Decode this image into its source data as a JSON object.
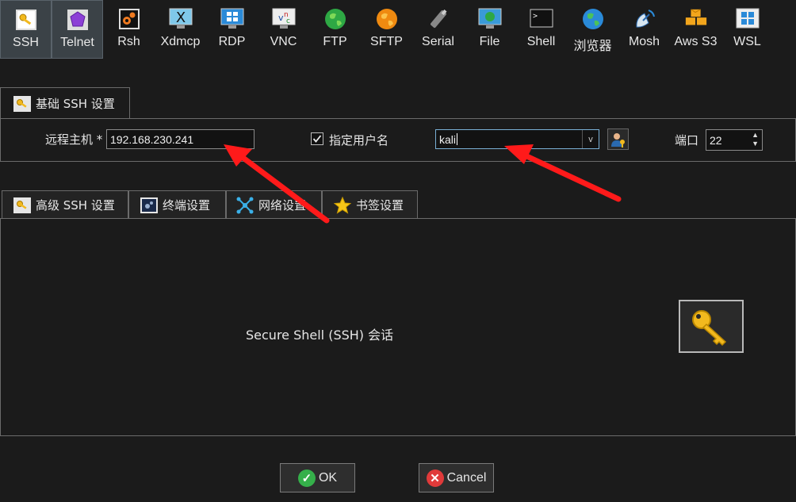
{
  "session_types": [
    {
      "label": "SSH",
      "icon": "ssh-key-icon",
      "active": true
    },
    {
      "label": "Telnet",
      "icon": "telnet-gem-icon",
      "active": true
    },
    {
      "label": "Rsh",
      "icon": "rsh-gears-icon"
    },
    {
      "label": "Xdmcp",
      "icon": "xdmcp-monitor-icon"
    },
    {
      "label": "RDP",
      "icon": "rdp-windows-monitor-icon"
    },
    {
      "label": "VNC",
      "icon": "vnc-icon"
    },
    {
      "label": "FTP",
      "icon": "ftp-globe-icon"
    },
    {
      "label": "SFTP",
      "icon": "sftp-globe-icon"
    },
    {
      "label": "Serial",
      "icon": "serial-plug-icon"
    },
    {
      "label": "File",
      "icon": "file-monitor-icon"
    },
    {
      "label": "Shell",
      "icon": "shell-terminal-icon"
    },
    {
      "label": "浏览器",
      "icon": "browser-globe-icon"
    },
    {
      "label": "Mosh",
      "icon": "mosh-satellite-icon"
    },
    {
      "label": "Aws S3",
      "icon": "aws-s3-boxes-icon"
    },
    {
      "label": "WSL",
      "icon": "wsl-windows-icon"
    }
  ],
  "basic_tab": {
    "label": "基础 SSH 设置",
    "icon": "ssh-key-icon"
  },
  "basic": {
    "remote_host_label": "远程主机 *",
    "remote_host_value": "192.168.230.241",
    "specify_user_label": "指定用户名",
    "specify_user_checked": true,
    "username_value": "kali",
    "port_label": "端口",
    "port_value": "22"
  },
  "advanced_tabs": [
    {
      "label": "高级 SSH 设置",
      "icon": "ssh-key-icon"
    },
    {
      "label": "终端设置",
      "icon": "terminal-gears-icon"
    },
    {
      "label": "网络设置",
      "icon": "network-icon"
    },
    {
      "label": "书签设置",
      "icon": "star-icon"
    }
  ],
  "panel": {
    "description": "Secure Shell (SSH) 会话",
    "icon": "large-key-icon"
  },
  "buttons": {
    "ok": "OK",
    "cancel": "Cancel"
  },
  "colors": {
    "accent_key": "#f2b91e",
    "arrow": "#ff1a1a",
    "ok_green": "#35b04a",
    "cancel_red": "#e03a3a"
  }
}
